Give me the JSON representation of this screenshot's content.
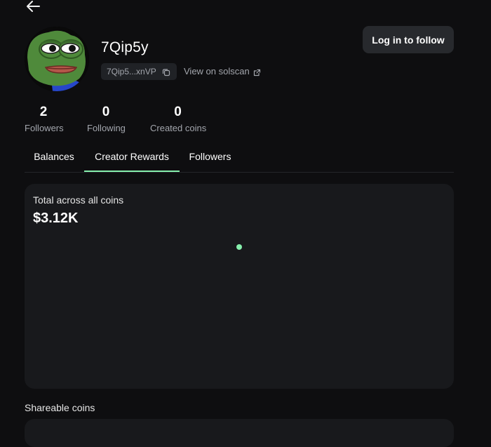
{
  "profile": {
    "username": "7Qip5y",
    "address_short": "7Qip5...xnVP",
    "solscan_label": "View on solscan",
    "follow_label": "Log in to follow"
  },
  "stats": [
    {
      "value": "2",
      "label": "Followers"
    },
    {
      "value": "0",
      "label": "Following"
    },
    {
      "value": "0",
      "label": "Created coins"
    }
  ],
  "tabs": [
    {
      "label": "Balances",
      "active": false
    },
    {
      "label": "Creator Rewards",
      "active": true
    },
    {
      "label": "Followers",
      "active": false
    }
  ],
  "rewards": {
    "total_label": "Total across all coins",
    "total_value": "$3.12K"
  },
  "sections": {
    "shareable_title": "Shareable coins"
  },
  "colors": {
    "accent": "#86efac",
    "background": "#0e0e10",
    "card": "#18191c",
    "muted_text": "#a3a6ad"
  },
  "icons": {
    "back": "arrow-left-icon",
    "copy": "copy-icon",
    "external": "external-link-icon"
  }
}
